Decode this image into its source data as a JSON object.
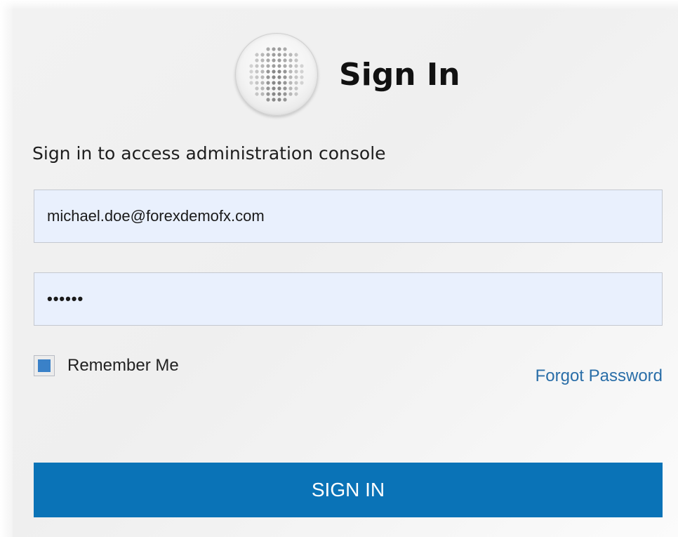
{
  "header": {
    "title": "Sign In",
    "logo_icon": "dotted-globe-logo-icon"
  },
  "subtitle": "Sign in to access administration console",
  "form": {
    "email_value": "michael.doe@forexdemofx.com",
    "password_value": "••••••",
    "remember_label": "Remember Me",
    "remember_checked": true,
    "forgot_label": "Forgot Password",
    "submit_label": "SIGN IN"
  },
  "colors": {
    "button": "#0a73b7",
    "link": "#2a6ea8",
    "input_bg": "#e9f0fd",
    "checkbox_fill": "#3a81c8"
  }
}
